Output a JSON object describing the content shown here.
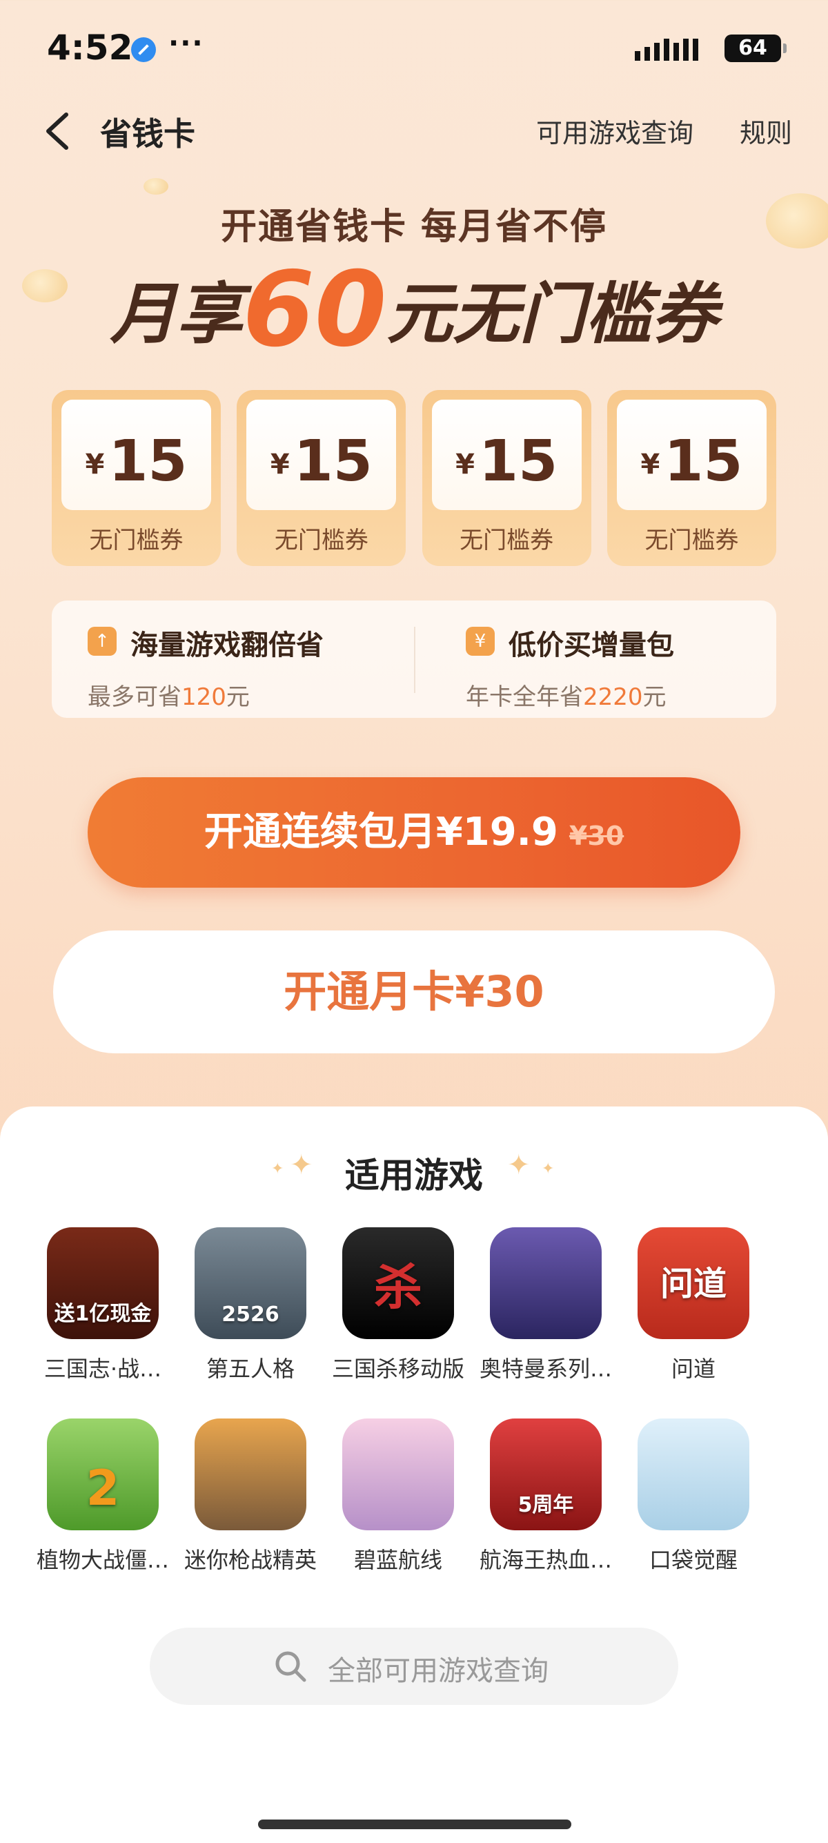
{
  "status_bar": {
    "time": "4:52",
    "dots": "···",
    "battery": "64"
  },
  "header": {
    "title": "省钱卡",
    "link_games": "可用游戏查询",
    "link_rules": "规则"
  },
  "hero": {
    "subtitle": "开通省钱卡  每月省不停",
    "prefix": "月享",
    "amount": "60",
    "suffix": "元无门槛券"
  },
  "coupons": [
    {
      "yen": "¥",
      "value": "15",
      "label": "无门槛券"
    },
    {
      "yen": "¥",
      "value": "15",
      "label": "无门槛券"
    },
    {
      "yen": "¥",
      "value": "15",
      "label": "无门槛券"
    },
    {
      "yen": "¥",
      "value": "15",
      "label": "无门槛券"
    }
  ],
  "benefits": {
    "left": {
      "title": "海量游戏翻倍省",
      "desc_pre": "最多可省",
      "desc_hl": "120",
      "desc_post": "元"
    },
    "right": {
      "title": "低价买增量包",
      "desc_pre": "年卡全年省",
      "desc_hl": "2220",
      "desc_post": "元"
    }
  },
  "buttons": {
    "primary": "开通连续包月¥19.9",
    "primary_original": "¥30",
    "secondary": "开通月卡¥30"
  },
  "games_section": {
    "title": "适用游戏",
    "games": [
      {
        "name": "三国志·战…",
        "icon": "sanguozhi-icon",
        "color": "#5b1e12",
        "overlay": "送1亿现金"
      },
      {
        "name": "第五人格",
        "icon": "identity-v-icon",
        "color": "#5a6b7a",
        "overlay": "2526"
      },
      {
        "name": "三国杀移动版",
        "icon": "sanguosha-icon",
        "color": "#1a1a1a",
        "overlay": "杀"
      },
      {
        "name": "奥特曼系列…",
        "icon": "ultraman-icon",
        "color": "#4a3a8a",
        "overlay": ""
      },
      {
        "name": "问道",
        "icon": "wendao-icon",
        "color": "#d9402e",
        "overlay": "问道"
      },
      {
        "name": "植物大战僵…",
        "icon": "pvz-icon",
        "color": "#6fb93a",
        "overlay": "2"
      },
      {
        "name": "迷你枪战精英",
        "icon": "mini-gun-icon",
        "color": "#d48a3a",
        "overlay": ""
      },
      {
        "name": "碧蓝航线",
        "icon": "azur-lane-icon",
        "color": "#e8b4d4",
        "overlay": ""
      },
      {
        "name": "航海王热血…",
        "icon": "one-piece-icon",
        "color": "#c62828",
        "overlay": "5周年"
      },
      {
        "name": "口袋觉醒",
        "icon": "pocket-icon",
        "color": "#cfe6f4",
        "overlay": ""
      }
    ],
    "search_placeholder": "全部可用游戏查询"
  },
  "colors": {
    "accent": "#f06a2e",
    "button_gradient_start": "#f07c34",
    "button_gradient_end": "#e85629"
  }
}
